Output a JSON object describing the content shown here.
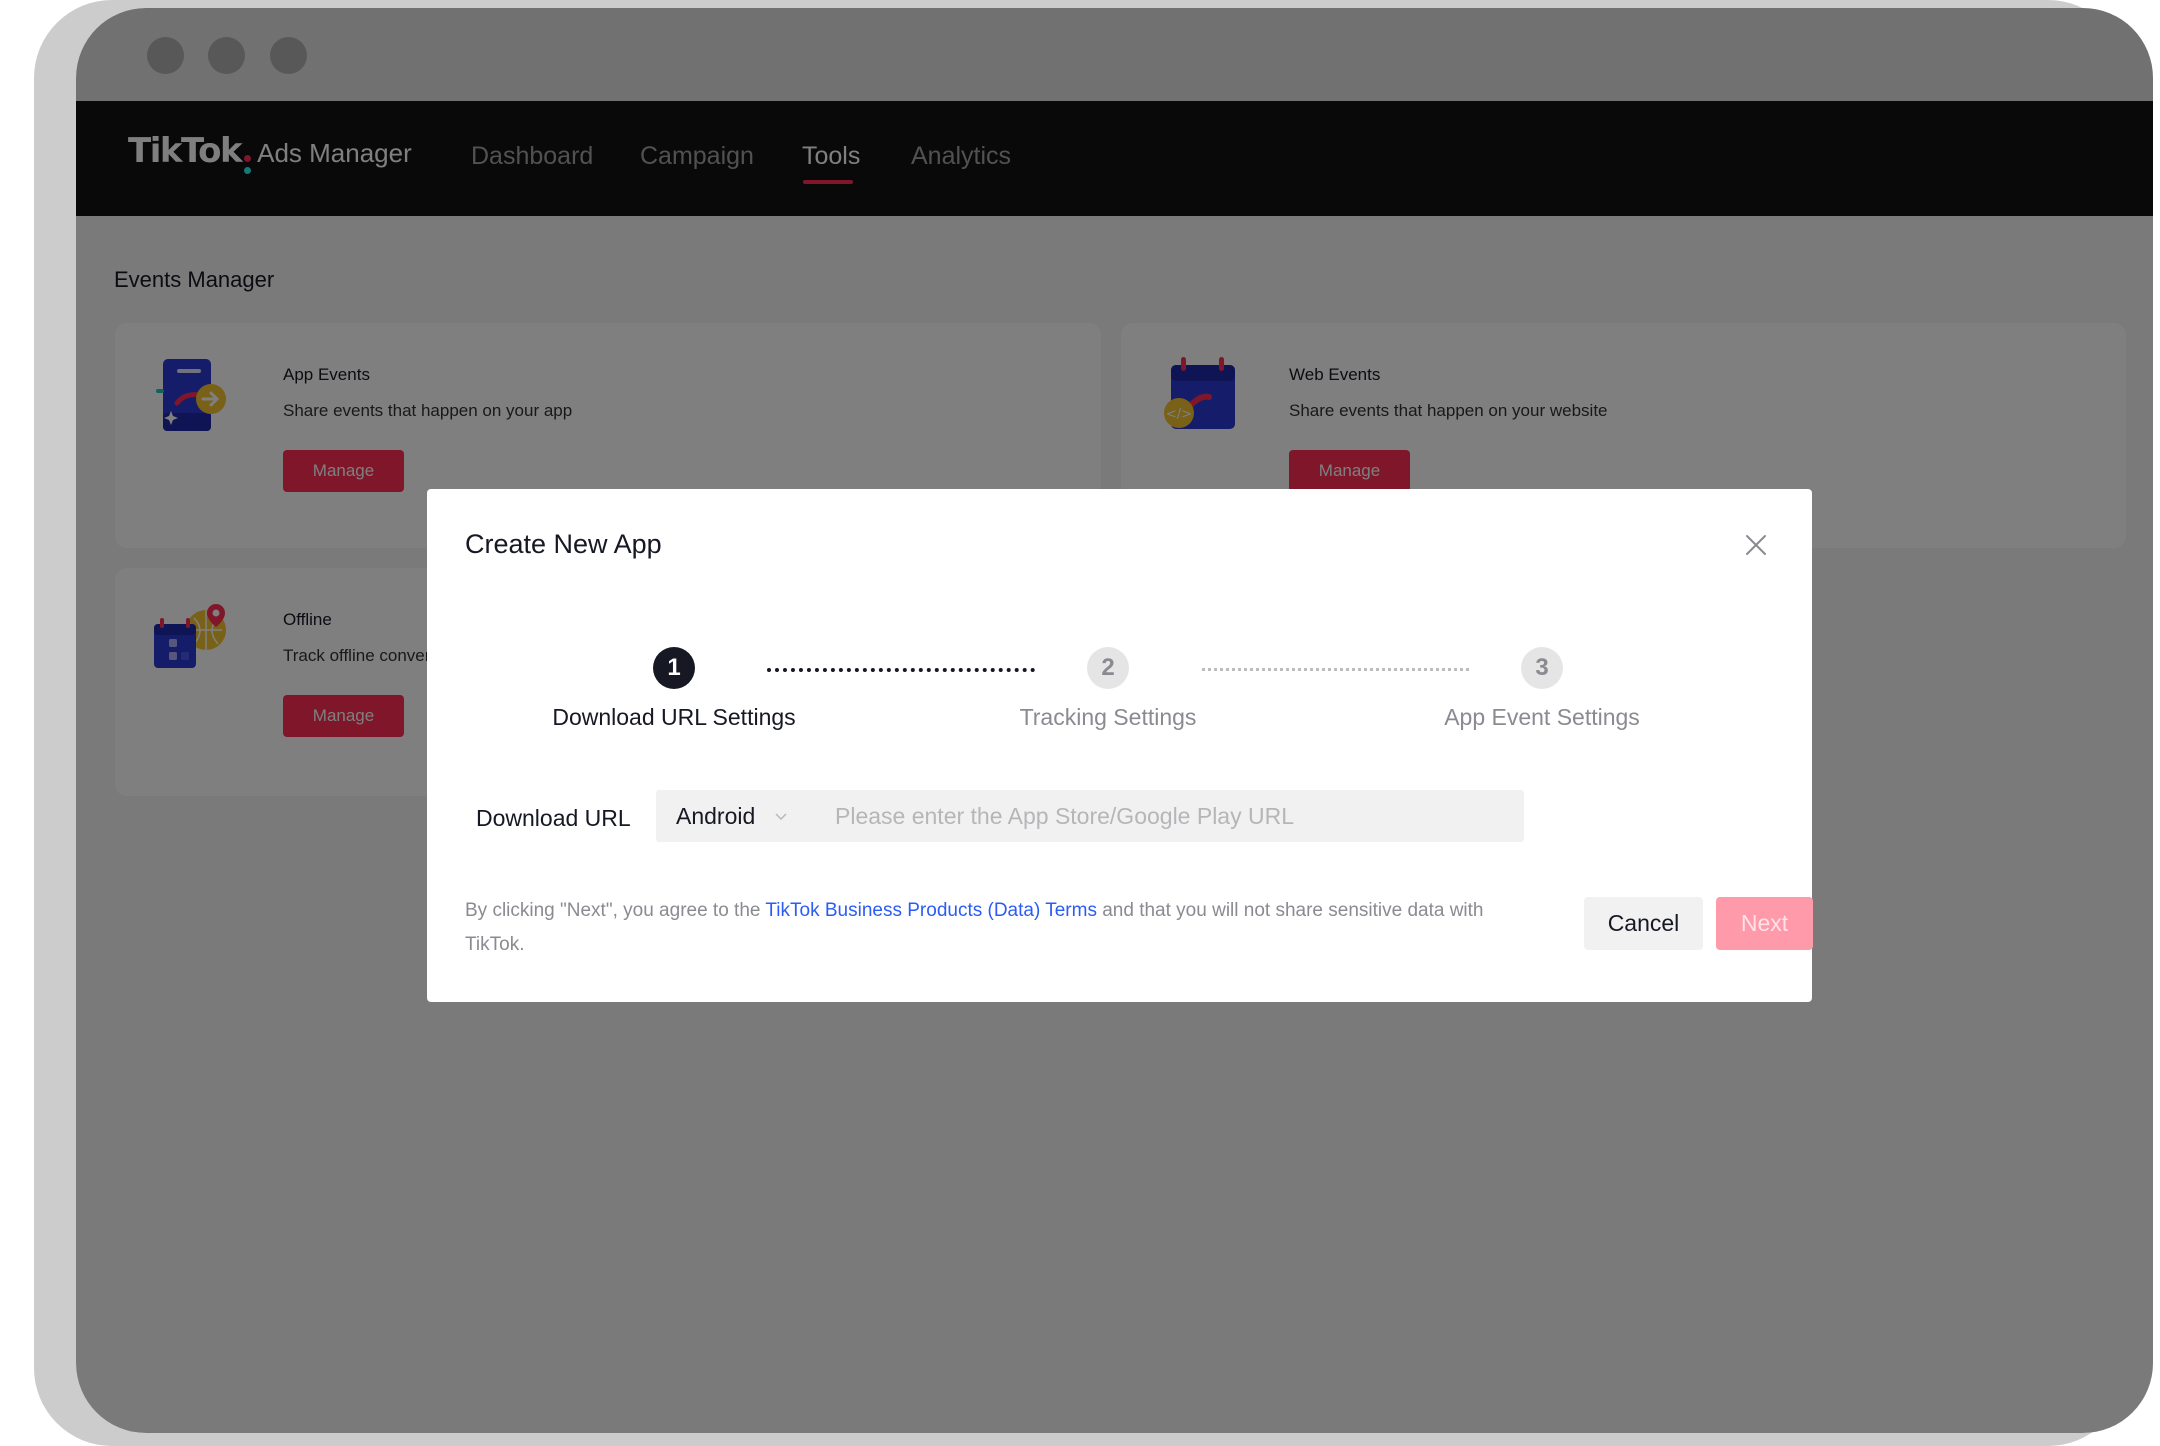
{
  "window": {
    "traffic_lights": [
      "close",
      "minimize",
      "maximize"
    ]
  },
  "nav": {
    "logo_mark": "TikTok",
    "logo_sub": "Ads Manager",
    "items": [
      {
        "label": "Dashboard",
        "active": false
      },
      {
        "label": "Campaign",
        "active": false
      },
      {
        "label": "Tools",
        "active": true
      },
      {
        "label": "Analytics",
        "active": false
      }
    ],
    "accent_color": "#fe2c55"
  },
  "page": {
    "title": "Events Manager",
    "cards": [
      {
        "title": "App Events",
        "description": "Share events that happen on your app",
        "button": "Manage",
        "icon": "app-phone-icon"
      },
      {
        "title": "Web Events",
        "description": "Share events that happen on your website",
        "button": "Manage",
        "icon": "web-calendar-code-icon"
      },
      {
        "title": "Offline",
        "description": "Track offline conversions",
        "button": "Manage",
        "icon": "offline-calendar-globe-icon"
      }
    ]
  },
  "modal": {
    "title": "Create New App",
    "close_icon": "close-icon",
    "steps": [
      {
        "number": "1",
        "label": "Download URL Settings",
        "active": true
      },
      {
        "number": "2",
        "label": "Tracking Settings",
        "active": false
      },
      {
        "number": "3",
        "label": "App Event Settings",
        "active": false
      }
    ],
    "download_url": {
      "label": "Download URL",
      "platform": "Android",
      "value": "",
      "placeholder": "Please enter the App Store/Google Play URL"
    },
    "terms": {
      "prefix": "By clicking \"Next\", you agree to the ",
      "link": "TikTok Business Products (Data) Terms",
      "suffix": " and that you will not share sensitive data with TikTok."
    },
    "cancel_label": "Cancel",
    "next_label": "Next",
    "next_disabled": true
  }
}
